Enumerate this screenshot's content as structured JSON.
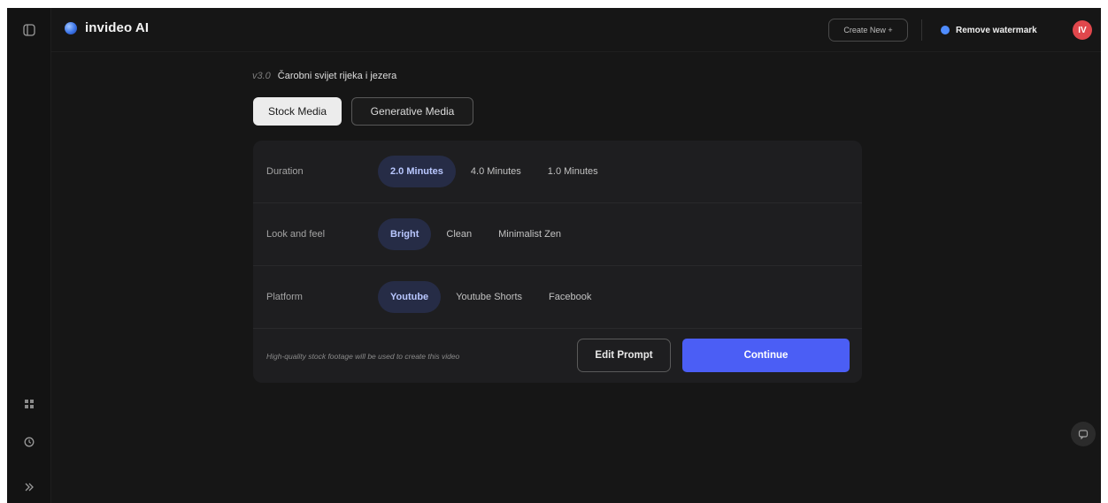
{
  "app": {
    "brand": "invideo AI"
  },
  "topbar": {
    "create_new_label": "Create New +",
    "remove_watermark_label": "Remove watermark",
    "avatar_initial": "IV"
  },
  "project": {
    "version": "v3.0",
    "title": "Čarobni svijet rijeka i jezera"
  },
  "media_tabs": [
    {
      "label": "Stock Media",
      "selected": true
    },
    {
      "label": "Generative Media",
      "selected": false
    }
  ],
  "settings": {
    "duration": {
      "label": "Duration",
      "options": [
        "2.0 Minutes",
        "4.0 Minutes",
        "1.0 Minutes"
      ],
      "selected": "2.0 Minutes"
    },
    "look_and_feel": {
      "label": "Look and feel",
      "options": [
        "Bright",
        "Clean",
        "Minimalist Zen"
      ],
      "selected": "Bright"
    },
    "platform": {
      "label": "Platform",
      "options": [
        "Youtube",
        "Youtube Shorts",
        "Facebook"
      ],
      "selected": "Youtube"
    }
  },
  "footer": {
    "note": "High-quality stock footage will be used to create this video",
    "edit_prompt_label": "Edit Prompt",
    "continue_label": "Continue"
  },
  "sidebar_icons": [
    "panel-toggle-icon",
    "grid-icon",
    "history-icon",
    "expand-icon"
  ],
  "colors": {
    "accent": "#4b5ef5",
    "selected_chip_bg": "#262c46",
    "avatar": "#e0474c"
  }
}
